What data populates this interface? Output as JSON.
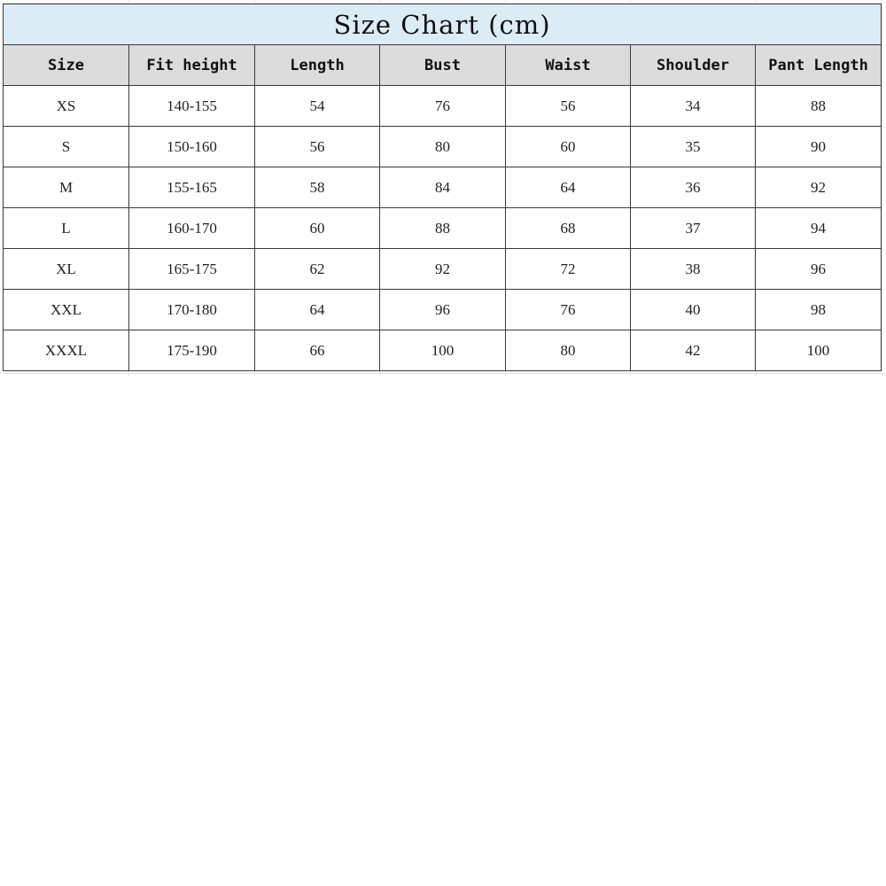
{
  "title": "Size Chart (cm)",
  "columns": [
    "Size",
    "Fit height",
    "Length",
    "Bust",
    "Waist",
    "Shoulder",
    "Pant Length"
  ],
  "rows": [
    [
      "XS",
      "140-155",
      "54",
      "76",
      "56",
      "34",
      "88"
    ],
    [
      "S",
      "150-160",
      "56",
      "80",
      "60",
      "35",
      "90"
    ],
    [
      "M",
      "155-165",
      "58",
      "84",
      "64",
      "36",
      "92"
    ],
    [
      "L",
      "160-170",
      "60",
      "88",
      "68",
      "37",
      "94"
    ],
    [
      "XL",
      "165-175",
      "62",
      "92",
      "72",
      "38",
      "96"
    ],
    [
      "XXL",
      "170-180",
      "64",
      "96",
      "76",
      "40",
      "98"
    ],
    [
      "XXXL",
      "175-190",
      "66",
      "100",
      "80",
      "42",
      "100"
    ]
  ],
  "colors": {
    "title_background": "#dcecf4",
    "header_background": "#dcdcdc",
    "border": "#3a3a3a"
  }
}
